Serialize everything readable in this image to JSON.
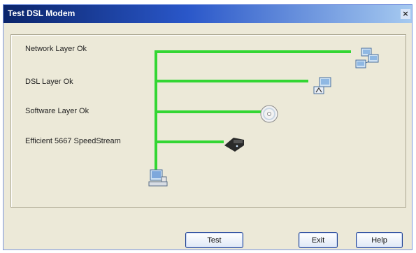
{
  "window": {
    "title": "Test DSL Modem",
    "close": "×"
  },
  "layers": [
    {
      "label": "Network Layer Ok",
      "icon": "network-computers-icon"
    },
    {
      "label": "DSL Layer Ok",
      "icon": "dsl-connection-icon"
    },
    {
      "label": "Software Layer Ok",
      "icon": "software-cd-icon"
    },
    {
      "label": "Efficient 5667 SpeedStream",
      "icon": "modem-device-icon"
    }
  ],
  "root_icon": "local-computer-icon",
  "colors": {
    "link_line": "#33d633",
    "title_start": "#0a246a",
    "face": "#ece9d8"
  },
  "buttons": {
    "test": "Test",
    "exit": "Exit",
    "help": "Help"
  }
}
